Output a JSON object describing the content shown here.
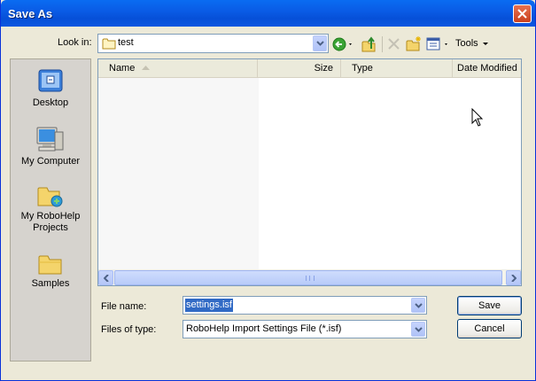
{
  "window": {
    "title": "Save As"
  },
  "lookin": {
    "label": "Look in:",
    "value": "test"
  },
  "toolbar": {
    "tools_label": "Tools"
  },
  "places": [
    {
      "label": "Desktop"
    },
    {
      "label": "My Computer"
    },
    {
      "label": "My RoboHelp Projects"
    },
    {
      "label": "Samples"
    }
  ],
  "filelist": {
    "columns": [
      "Name",
      "Size",
      "Type",
      "Date Modified"
    ]
  },
  "filename": {
    "label": "File name:",
    "value": "settings.isf"
  },
  "filetype": {
    "label": "Files of type:",
    "value": "RoboHelp Import Settings File (*.isf)"
  },
  "buttons": {
    "save": "Save",
    "cancel": "Cancel"
  },
  "colors": {
    "titlebar": "#0a5ce6",
    "dialog_bg": "#ece9d8",
    "selection": "#316ac5"
  }
}
